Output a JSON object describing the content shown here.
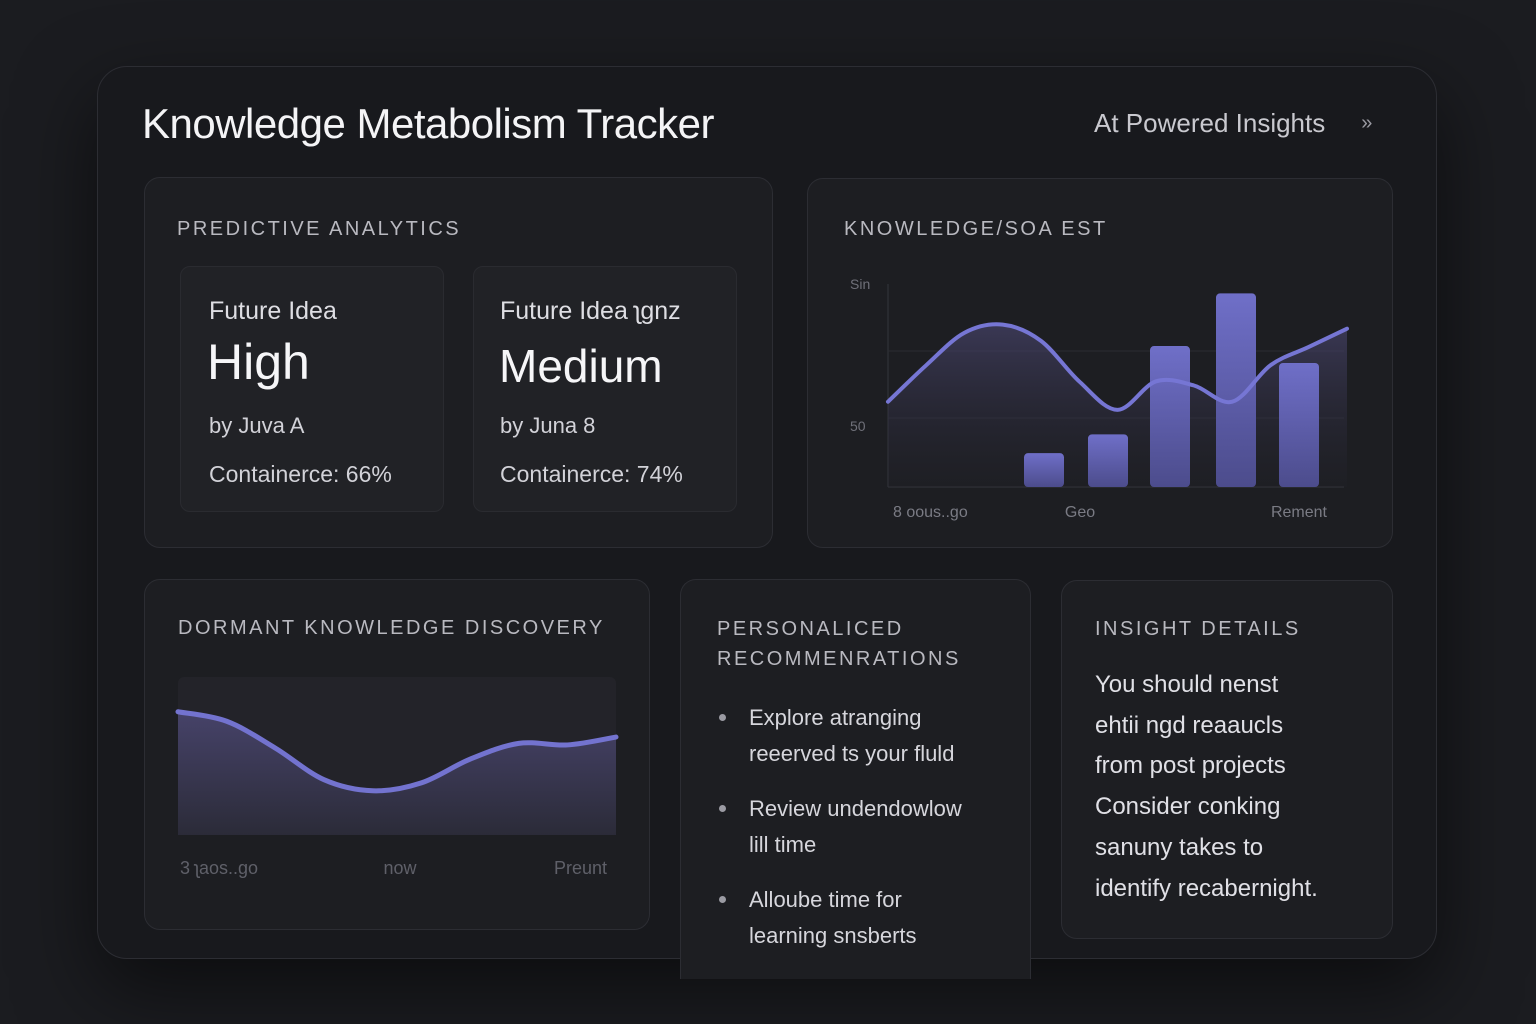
{
  "header": {
    "title": "Knowledge Metabolism Tracker",
    "insights_link": "At Powered Insights",
    "chevron_icon": "double-chevron-right-icon"
  },
  "predictive": {
    "label": "PREDICTIVE ANALYTICS",
    "cards": [
      {
        "title": "Future Idea",
        "level": "High",
        "by": "by Juva A",
        "confidence": "Containerce: 66%"
      },
      {
        "title": "Future Idea ʅɡnz",
        "level": "Medium",
        "by": "by  Juna 8",
        "confidence": "Containerce: 74%"
      }
    ]
  },
  "knowledge_chart": {
    "label": "KNOWLEDGE/SOA EST"
  },
  "chart_data": [
    {
      "type": "bar",
      "title": "KNOWLEDGE/SOA EST",
      "y_tick_labels": [
        "Sin",
        "50"
      ],
      "x_tick_labels": [
        "8 oous..go",
        "Geo",
        "Rement"
      ],
      "categories": [
        "b1",
        "b2",
        "b3",
        "b4",
        "b5"
      ],
      "series": [
        {
          "values": [
            18,
            28,
            75,
            103,
            66
          ]
        }
      ],
      "line_overlay": [
        0.42,
        0.6,
        0.76,
        0.8,
        0.72,
        0.52,
        0.38,
        0.52,
        0.5,
        0.42,
        0.6,
        0.69,
        0.78
      ],
      "ylim": [
        0,
        108
      ],
      "grid": true,
      "accent": "#6b6bc4"
    },
    {
      "type": "area",
      "title": "DORMANT KNOWLEDGE DISCOVERY",
      "x_tick_labels": [
        "3 ʅaos..go",
        "now",
        "Preunt"
      ],
      "y": [
        0.78,
        0.72,
        0.55,
        0.35,
        0.28,
        0.33,
        0.48,
        0.58,
        0.57,
        0.62
      ],
      "ylim": [
        0,
        1
      ],
      "accent": "#7373cf"
    }
  ],
  "dormant": {
    "label": "DORMANT KNOWLEDGE DISCOVERY"
  },
  "recommendations": {
    "label_line1": "PERSONALICED",
    "label_line2": "RECOMMENRATIONS",
    "items": [
      {
        "line1": "Explore atranging",
        "line2": "reeerved ts your fluld"
      },
      {
        "line1": "Review undendowlow",
        "line2": "lill time"
      },
      {
        "line1": "Alloube time for",
        "line2": "learning snsberts"
      }
    ]
  },
  "insight": {
    "label": "INSIGHT DETAILS",
    "lines": [
      "You should nenst",
      "ehtii ngd reaaucls",
      "from post projects",
      "Consider conking",
      "sanuny takes to",
      "identify recabernight."
    ]
  },
  "colors": {
    "background": "#1b1c20",
    "panel": "#1d1e22",
    "accent": "#6b6bc4",
    "text": "#e6e6ea"
  }
}
